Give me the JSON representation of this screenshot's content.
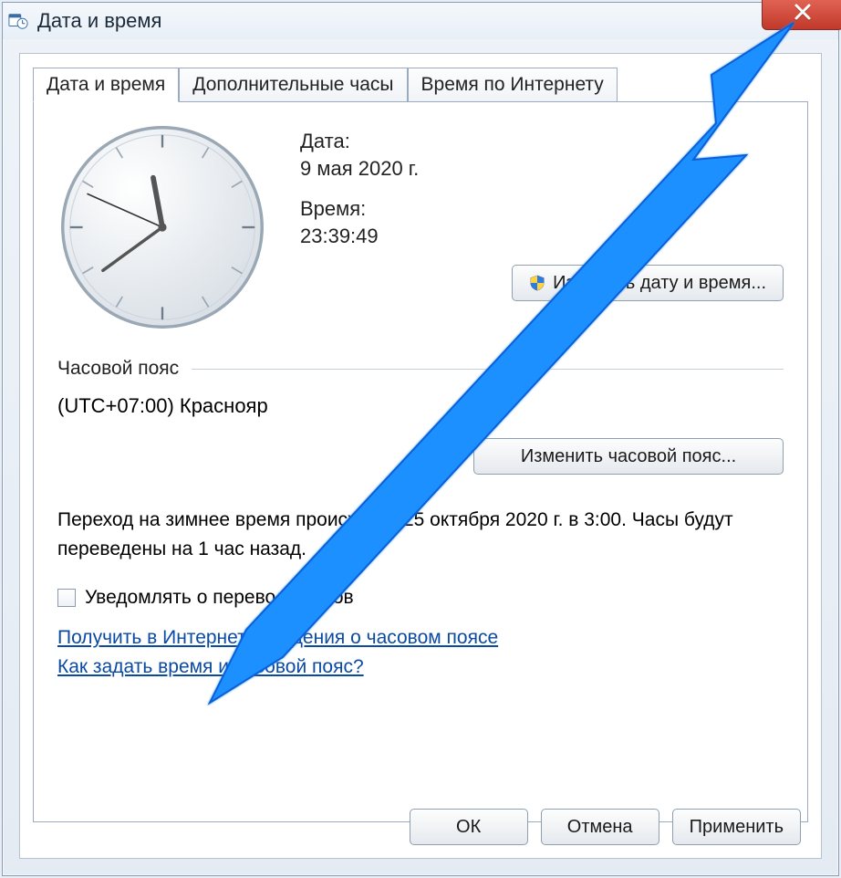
{
  "window": {
    "title": "Дата и время"
  },
  "tabs": [
    {
      "label": "Дата и время"
    },
    {
      "label": "Дополнительные часы"
    },
    {
      "label": "Время по Интернету"
    }
  ],
  "datetime": {
    "date_label": "Дата:",
    "date_value": "9 мая 2020 г.",
    "time_label": "Время:",
    "time_value": "23:39:49",
    "change_button": "Изменить дату и время..."
  },
  "timezone": {
    "group_label": "Часовой пояс",
    "value": "(UTC+07:00) Краснояр",
    "change_button": "Изменить часовой пояс..."
  },
  "dst": {
    "text": "Переход на зимнее время происходит 25 октября 2020 г. в 3:00. Часы будут переведены на 1 час назад.",
    "checkbox_label": "Уведомлять о переводе часов"
  },
  "links": {
    "tz_info": "Получить в Интернете сведения о часовом поясе",
    "howto": "Как задать время и часовой пояс?"
  },
  "buttons": {
    "ok": "ОК",
    "cancel": "Отмена",
    "apply": "Применить"
  },
  "clock": {
    "hour": 11,
    "minute": 39,
    "second": 49
  },
  "colors": {
    "accent_arrow": "#1e90ff",
    "close_red": "#c9473a"
  }
}
